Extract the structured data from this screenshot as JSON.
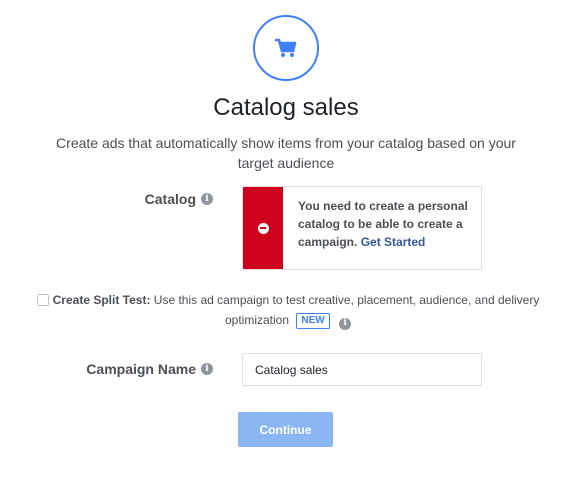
{
  "header": {
    "icon": "shopping-cart-icon",
    "title": "Catalog sales",
    "subtitle": "Create ads that automatically show items from your catalog based on your target audience"
  },
  "catalog": {
    "label": "Catalog",
    "alert": {
      "message": "You need to create a personal catalog to be able to create a campaign.",
      "link_text": "Get Started",
      "color": "#d0021b"
    }
  },
  "split_test": {
    "checked": false,
    "label": "Create Split Test:",
    "description": "Use this ad campaign to test creative, placement, audience, and delivery optimization",
    "badge": "NEW"
  },
  "campaign_name": {
    "label": "Campaign Name",
    "value": "Catalog sales"
  },
  "actions": {
    "continue_label": "Continue",
    "accent_color": "#4080ff"
  }
}
